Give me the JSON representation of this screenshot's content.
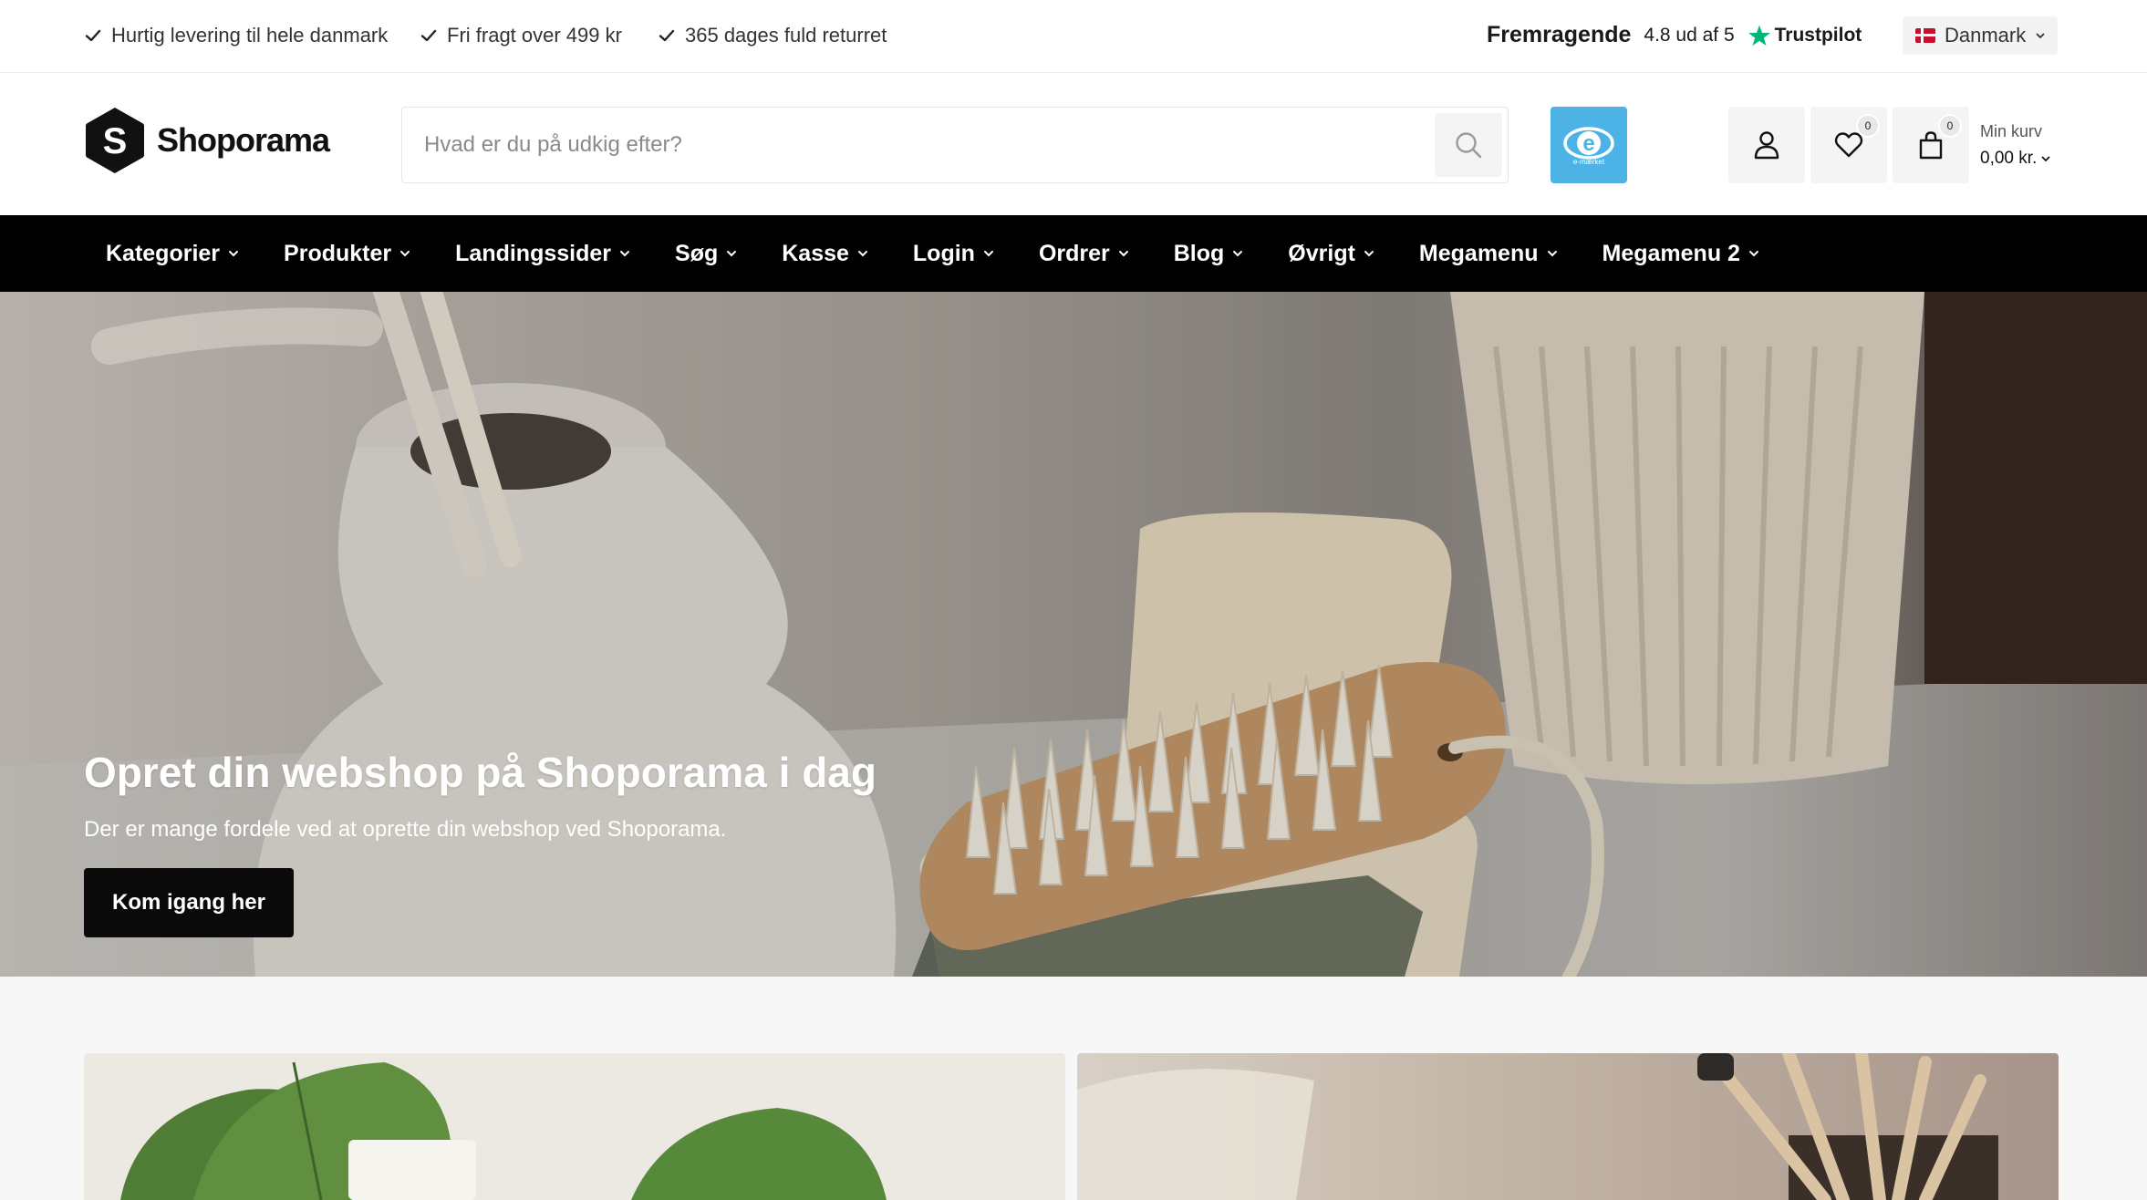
{
  "topbar": {
    "usps": [
      "Hurtig levering til hele danmark",
      "Fri fragt over 499 kr",
      "365 dages fuld returret"
    ],
    "trustpilot": {
      "rating_word": "Fremragende",
      "score_text": "4.8 ud af 5",
      "brand": "Trustpilot",
      "star_color": "#00b67a"
    },
    "country": "Danmark"
  },
  "header": {
    "logo_letter": "S",
    "logo_text": "Shoporama",
    "search_placeholder": "Hvad er du på udkig efter?",
    "emaerket_label": "e-mærket",
    "wishlist_count": "0",
    "cart_count": "0",
    "cart_label": "Min kurv",
    "cart_total": "0,00 kr."
  },
  "nav": {
    "items": [
      "Kategorier",
      "Produkter",
      "Landingssider",
      "Søg",
      "Kasse",
      "Login",
      "Ordrer",
      "Blog",
      "Øvrigt",
      "Megamenu",
      "Megamenu 2"
    ]
  },
  "hero": {
    "title": "Opret din webshop på Shoporama i dag",
    "subtitle": "Der er mange fordele ved at oprette din webshop ved Shoporama.",
    "cta": "Kom igang her"
  },
  "colors": {
    "accent": "#000000",
    "emaerket": "#4db3e6"
  },
  "icons": [
    "check-icon",
    "trustpilot-star-icon",
    "chevron-down-icon",
    "search-icon",
    "user-icon",
    "heart-icon",
    "bag-icon"
  ]
}
